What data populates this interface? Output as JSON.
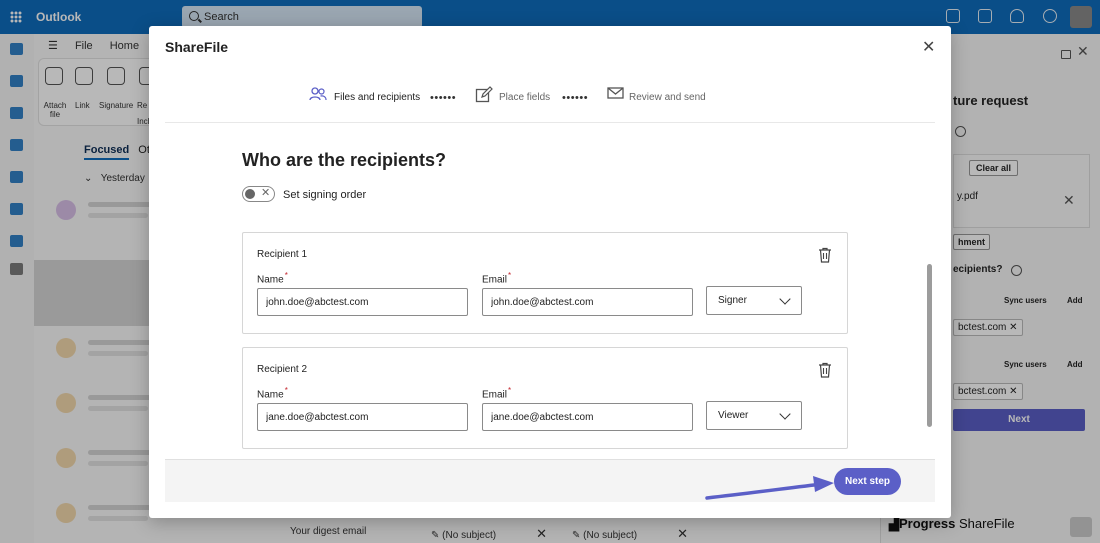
{
  "outlook": {
    "app_name": "Outlook",
    "search_placeholder": "Search",
    "menu": [
      "File",
      "Home"
    ],
    "ribbon": [
      "Attach file",
      "Link",
      "Signature",
      "Re"
    ],
    "ribbon_group": "Inclu",
    "focused_tab": "Focused",
    "other_tab": "Ot",
    "group_header": "Yesterday",
    "bottom_tabs": [
      "Your digest email",
      "(No subject)",
      "(No subject)"
    ]
  },
  "right_panel": {
    "title": "ture request",
    "clear_all": "Clear all",
    "file": "y.pdf",
    "attachment_btn": "hment",
    "recipients_label": "ecipients?",
    "sync_users": "Sync users",
    "add": "Add",
    "chip_1": "bctest.com",
    "chip_2": "bctest.com",
    "next": "Next",
    "brand_bold": "Progress",
    "brand_light": "ShareFile"
  },
  "modal": {
    "title": "ShareFile",
    "steps": [
      {
        "label": "Files and recipients",
        "icon": "people-icon",
        "active": true
      },
      {
        "label": "Place fields",
        "icon": "edit-box-icon",
        "active": false
      },
      {
        "label": "Review and send",
        "icon": "envelope-icon",
        "active": false
      }
    ],
    "step_dots": "••••••",
    "heading": "Who are the recipients?",
    "signing_order_label": "Set signing order",
    "toggle_on": false,
    "recipients": [
      {
        "title": "Recipient 1",
        "name_label": "Name",
        "email_label": "Email",
        "name": "john.doe@abctest.com",
        "email": "john.doe@abctest.com",
        "role": "Signer"
      },
      {
        "title": "Recipient 2",
        "name_label": "Name",
        "email_label": "Email",
        "name": "jane.doe@abctest.com",
        "email": "jane.doe@abctest.com",
        "role": "Viewer"
      }
    ],
    "next_step": "Next step"
  },
  "colors": {
    "outlook_blue": "#0f6cbd",
    "accent_purple": "#5b5fc7",
    "required_red": "#c4262e"
  }
}
